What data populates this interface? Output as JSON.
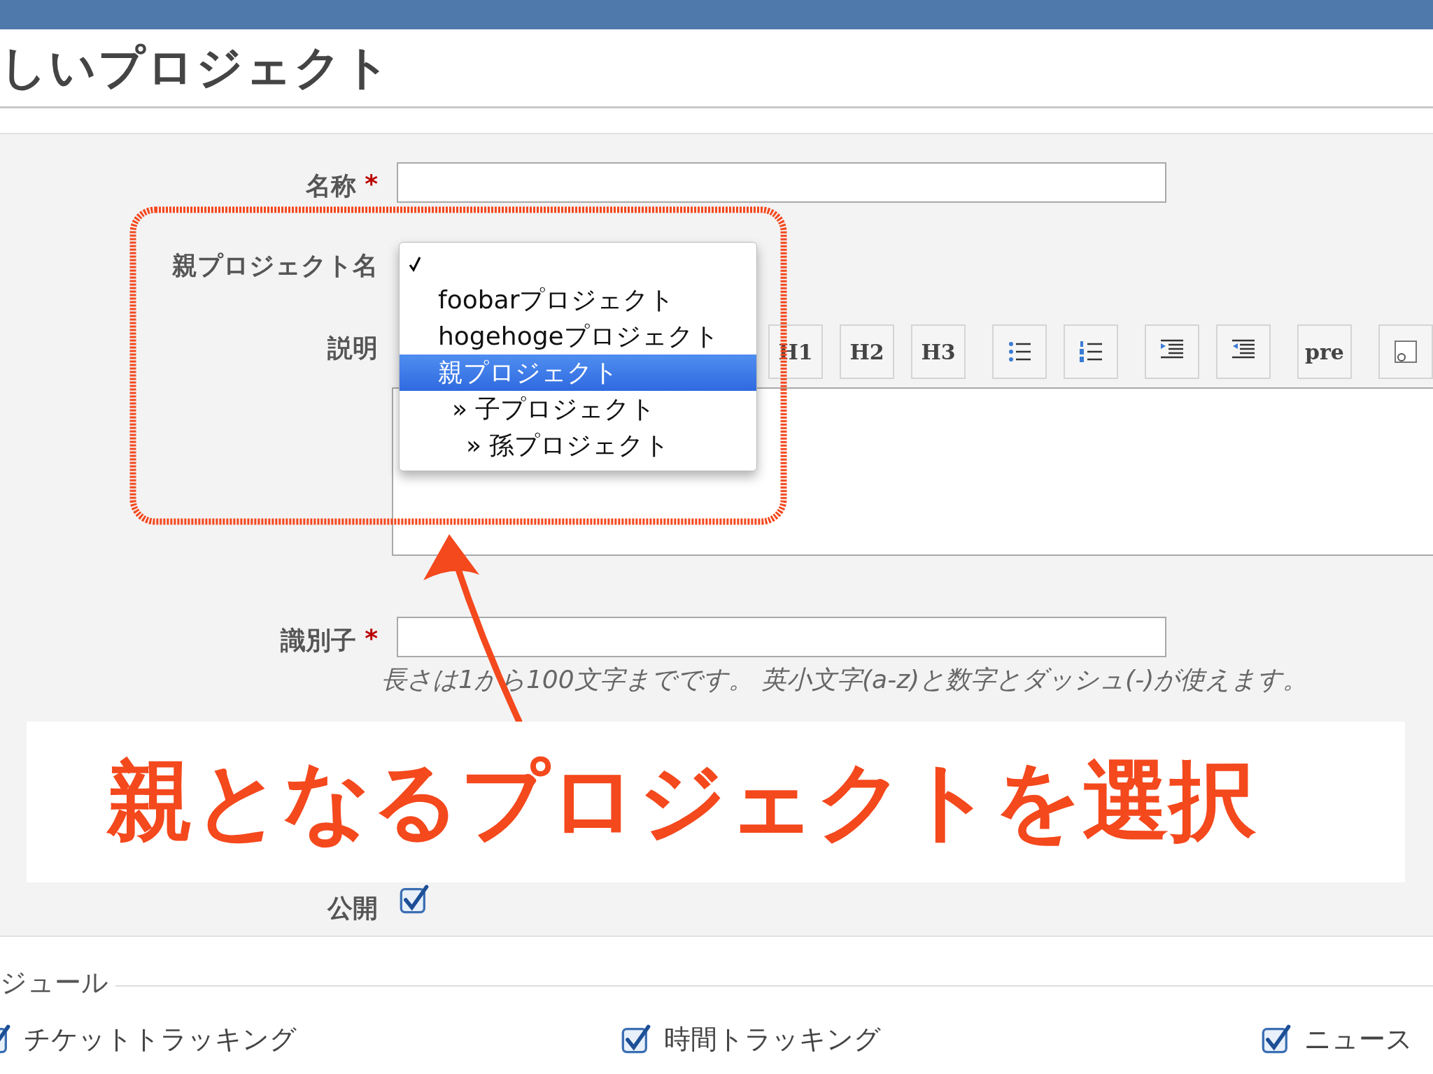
{
  "header": {
    "title": "しいプロジェクト"
  },
  "form": {
    "name_field": {
      "label": "名称",
      "required_mark": "*"
    },
    "parent_field": {
      "label": "親プロジェクト名",
      "options": [
        {
          "checked": true,
          "selected": false
        },
        {
          "label": "foobarプロジェクト",
          "checked": false,
          "selected": false
        },
        {
          "label": "hogehogeプロジェクト",
          "checked": false,
          "selected": false
        },
        {
          "label": "親プロジェクト",
          "checked": false,
          "selected": true,
          "children": [
            {
              "label": "» 子プロジェクト",
              "checked": false,
              "selected": false,
              "children": [
                {
                  "label": "» 孫プロジェクト",
                  "checked": false,
                  "selected": false
                }
              ]
            }
          ]
        }
      ]
    },
    "description_field": {
      "label": "説明",
      "toolbar_groups": [
        [
          {
            "kind": "text",
            "label": "H1"
          },
          {
            "kind": "text",
            "label": "H2"
          },
          {
            "kind": "text",
            "label": "H3"
          }
        ],
        [
          {
            "kind": "bullet-list"
          },
          {
            "kind": "numbered-list"
          }
        ],
        [
          {
            "kind": "indent"
          },
          {
            "kind": "outdent"
          }
        ],
        [
          {
            "kind": "text",
            "label": "pre"
          }
        ],
        [
          {
            "kind": "image"
          }
        ]
      ]
    },
    "identifier_field": {
      "label": "識別子",
      "required_mark": "*",
      "hints": [
        "長さは1から100文字までです。 英小文字(a-z)と数字とダッシュ(-)が使えます。"
      ]
    },
    "public_field": {
      "label": "公開",
      "checked": true
    }
  },
  "modules": {
    "legend": "ジュール",
    "items": [
      {
        "label": "チケットトラッキング",
        "checked": true
      },
      {
        "label": "時間トラッキング",
        "checked": true
      },
      {
        "label": "ニュース",
        "checked": true
      }
    ]
  },
  "annotation": {
    "text": "親となるプロジェクトを選択"
  }
}
